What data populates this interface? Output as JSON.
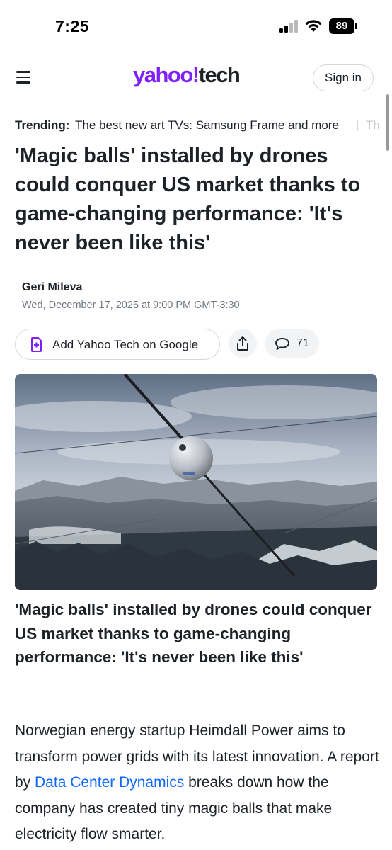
{
  "status_bar": {
    "time": "7:25",
    "battery": "89"
  },
  "header": {
    "logo_brand": "yahoo!",
    "logo_section": "tech",
    "sign_in_label": "Sign in"
  },
  "trending": {
    "label": "Trending:",
    "item": "The best new art TVs: Samsung Frame and more",
    "next_item": "Th"
  },
  "article": {
    "headline": "'Magic balls' installed by drones could conquer US market thanks to game-changing performance: 'It's never been like this'",
    "author": "Geri Mileva",
    "date": "Wed, December 17, 2025 at 9:00 PM GMT-3:30",
    "add_google_label": "Add Yahoo Tech on Google",
    "comment_count": "71",
    "image_caption": "'Magic balls' installed by drones could conquer US market thanks to game-changing performance: 'It's never been like this'",
    "body": {
      "before_link": "Norwegian energy startup Heimdall Power aims to transform power grids with its latest innovation. A report by ",
      "link_text": "Data Center Dynamics",
      "after_link": " breaks down how the company has created tiny magic balls that make electricity flow smarter."
    }
  },
  "colors": {
    "brand_purple": "#7e1fff",
    "link_blue": "#0f69ff",
    "text": "#1d2228",
    "muted": "#6e7780"
  },
  "icons": [
    "menu-icon",
    "share-icon",
    "comment-icon",
    "google-add-icon",
    "wifi-icon",
    "signal-icon",
    "battery-icon"
  ]
}
